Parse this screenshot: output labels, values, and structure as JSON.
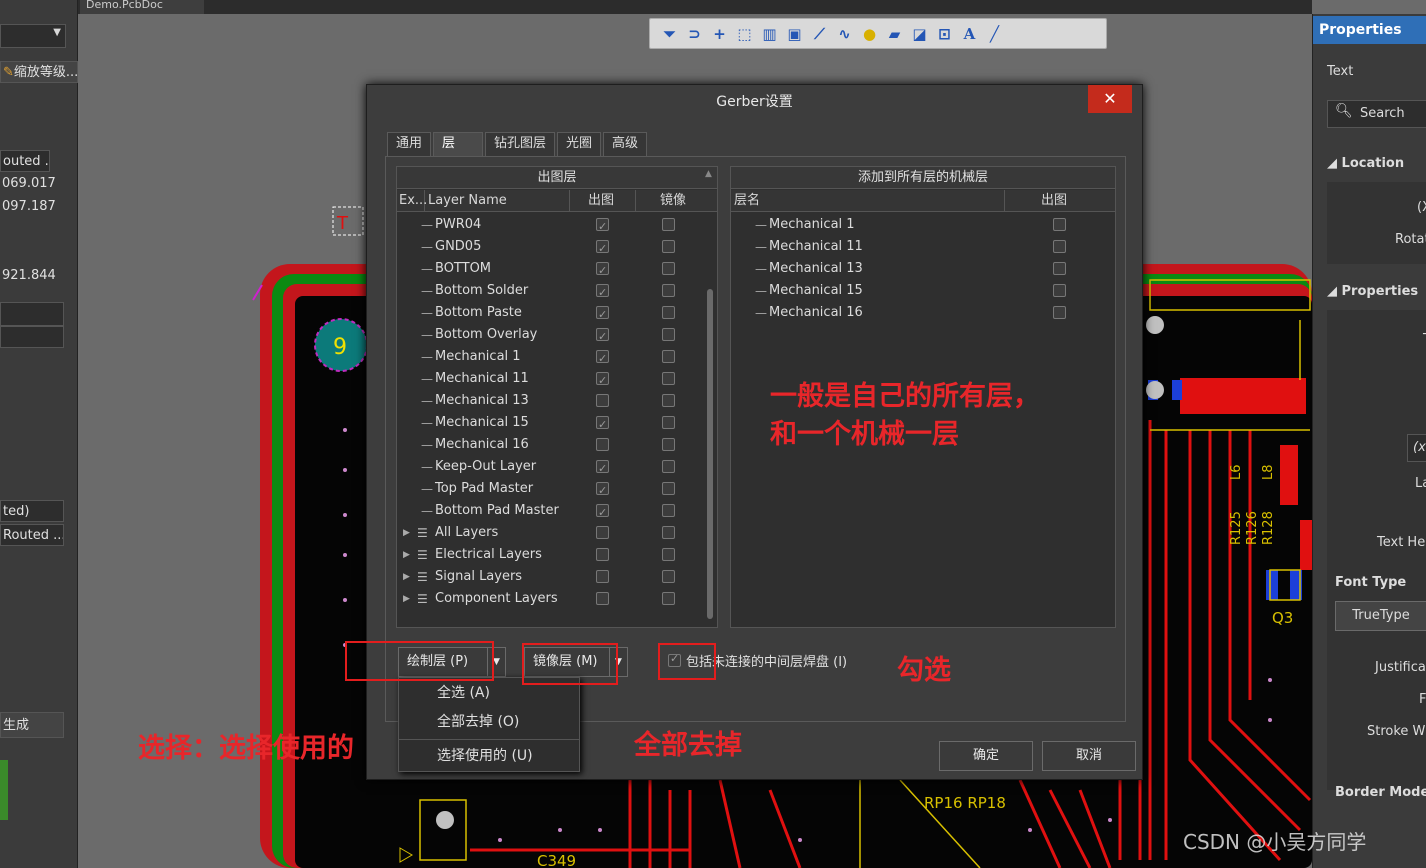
{
  "doc_tab": "Demo.PcbDoc",
  "left_panel": {
    "zoom_label": "缩放等级...",
    "rows": [
      "outed ...",
      "069.017",
      "097.187",
      "921.844",
      "ted)",
      "Routed ...",
      "生成"
    ]
  },
  "toolbar_icons": [
    "filter-icon",
    "route-icon",
    "plus-icon",
    "select-rect-icon",
    "chart-icon",
    "component-icon",
    "interactive-route-icon",
    "arc-icon",
    "pin-icon",
    "fill-icon",
    "region-icon",
    "dimension-icon",
    "text-icon",
    "line-icon"
  ],
  "right_panel": {
    "title": "Properties",
    "text_label": "Text",
    "search_placeholder": "Search",
    "location": "Location",
    "x_label": "(X",
    "rotation_label": "Rotat",
    "properties": "Properties",
    "t_label": "T",
    "xy_field": "(x",
    "layer_label": "La",
    "text_height": "Text Hei",
    "font_type": "Font Type",
    "truetype": "TrueType",
    "justification": "Justificat",
    "f_label": "F",
    "stroke_width": "Stroke Wi",
    "border_mode": "Border Mode"
  },
  "dialog": {
    "title": "Gerber设置",
    "close": "✕",
    "tabs": [
      "通用",
      "层",
      "钻孔图层",
      "光圈",
      "高级"
    ],
    "active_tab": 1,
    "left_panel": {
      "header": "出图层",
      "col_ex": "Ex...",
      "col_name": "Layer Name",
      "col_plot": "出图",
      "col_mirror": "镜像",
      "layers": [
        {
          "name": "PWR04",
          "plot": true,
          "mirror": false,
          "group": false
        },
        {
          "name": "GND05",
          "plot": true,
          "mirror": false,
          "group": false
        },
        {
          "name": "BOTTOM",
          "plot": true,
          "mirror": false,
          "group": false
        },
        {
          "name": "Bottom Solder",
          "plot": true,
          "mirror": false,
          "group": false
        },
        {
          "name": "Bottom Paste",
          "plot": true,
          "mirror": false,
          "group": false
        },
        {
          "name": "Bottom Overlay",
          "plot": true,
          "mirror": false,
          "group": false
        },
        {
          "name": "Mechanical 1",
          "plot": true,
          "mirror": false,
          "group": false
        },
        {
          "name": "Mechanical 11",
          "plot": true,
          "mirror": false,
          "group": false
        },
        {
          "name": "Mechanical 13",
          "plot": false,
          "mirror": false,
          "group": false
        },
        {
          "name": "Mechanical 15",
          "plot": true,
          "mirror": false,
          "group": false
        },
        {
          "name": "Mechanical 16",
          "plot": false,
          "mirror": false,
          "group": false
        },
        {
          "name": "Keep-Out Layer",
          "plot": true,
          "mirror": false,
          "group": false
        },
        {
          "name": "Top Pad Master",
          "plot": true,
          "mirror": false,
          "group": false
        },
        {
          "name": "Bottom Pad Master",
          "plot": true,
          "mirror": false,
          "group": false
        },
        {
          "name": "All Layers",
          "plot": false,
          "mirror": false,
          "group": true
        },
        {
          "name": "Electrical Layers",
          "plot": false,
          "mirror": false,
          "group": true
        },
        {
          "name": "Signal Layers",
          "plot": false,
          "mirror": false,
          "group": true
        },
        {
          "name": "Component Layers",
          "plot": false,
          "mirror": false,
          "group": true
        }
      ]
    },
    "right_panel": {
      "header": "添加到所有层的机械层",
      "col_name": "层名",
      "col_plot": "出图",
      "layers": [
        "Mechanical 1",
        "Mechanical 11",
        "Mechanical 13",
        "Mechanical 15",
        "Mechanical 16"
      ]
    },
    "plot_layers_button": "绘制层 (P)",
    "mirror_layers_button": "镜像层 (M)",
    "include_checkbox": "包括未连接的中间层焊盘 (I)",
    "include_checked": true,
    "ok": "确定",
    "cancel": "取消"
  },
  "dropdown_menu": [
    "全选 (A)",
    "全部去掉 (O)",
    "选择使用的 (U)"
  ],
  "annotations": {
    "note1": "一般是自己的所有层，",
    "note2": "和一个机械一层",
    "check": "勾选",
    "remove_all": "全部去掉",
    "select": "选择：选择使用的"
  },
  "pcb": {
    "designator_9": "9",
    "labels": [
      "C349",
      "RP16",
      "RP18",
      "Q3",
      "R125",
      "R126",
      "R128",
      "L6",
      "L8"
    ]
  },
  "watermark": "CSDN @小吴方同学",
  "colors": {
    "annotation_red": "#e8262a",
    "close_red": "#c42b1c",
    "pcb_black": "#000000",
    "track_red": "#e01010",
    "green": "#0a8a0a"
  }
}
